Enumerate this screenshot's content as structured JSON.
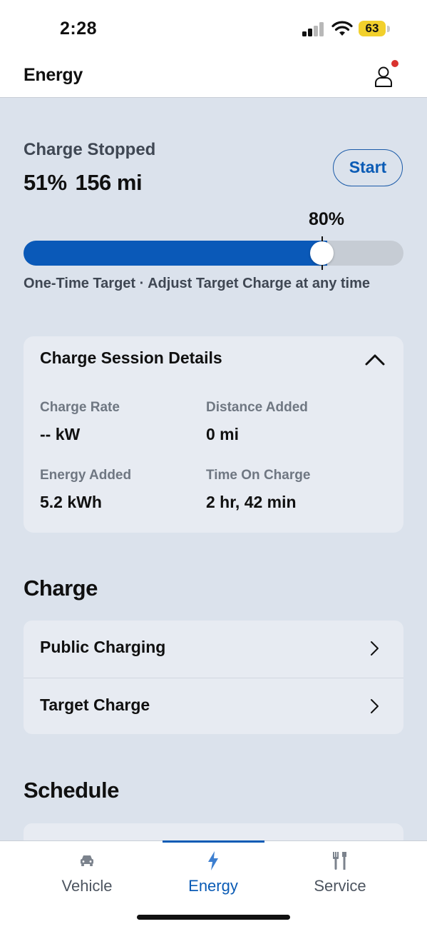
{
  "status_bar": {
    "time": "2:28",
    "battery": "63"
  },
  "header": {
    "title": "Energy"
  },
  "charge": {
    "status": "Charge Stopped",
    "battery_percent": "51%",
    "range": "156 mi",
    "start_label": "Start",
    "target_label": "80%",
    "current_level_fraction": 0.51,
    "target_level_fraction": 0.8,
    "caption": "One-Time Target · Adjust Target Charge at any time"
  },
  "session": {
    "title": "Charge Session Details",
    "details": [
      {
        "label": "Charge Rate",
        "value": "-- kW"
      },
      {
        "label": "Distance Added",
        "value": "0 mi"
      },
      {
        "label": "Energy Added",
        "value": "5.2 kWh"
      },
      {
        "label": "Time On Charge",
        "value": "2 hr, 42 min"
      }
    ]
  },
  "charge_section": {
    "heading": "Charge",
    "items": [
      {
        "label": "Public Charging"
      },
      {
        "label": "Target Charge"
      }
    ]
  },
  "schedule_section": {
    "heading": "Schedule"
  },
  "tabs": [
    {
      "label": "Vehicle",
      "icon": "car-icon"
    },
    {
      "label": "Energy",
      "icon": "lightning-icon"
    },
    {
      "label": "Service",
      "icon": "tools-icon"
    }
  ],
  "colors": {
    "accent": "#0a5bb5",
    "background": "#dbe2ec",
    "card": "#e7ebf2",
    "notification": "#d9322e"
  }
}
